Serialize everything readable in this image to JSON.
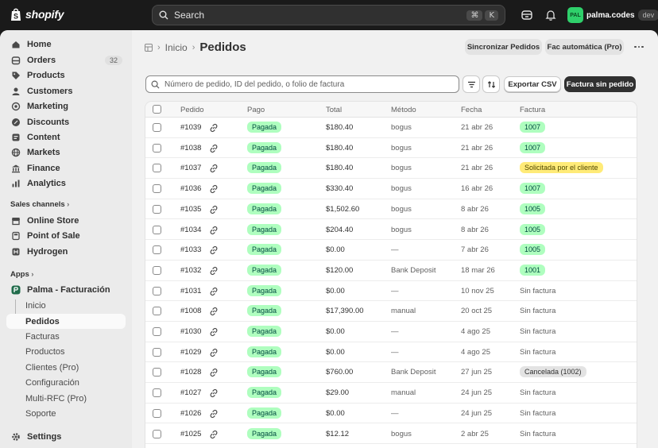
{
  "topbar": {
    "brand": "shopify",
    "search_placeholder": "Search",
    "shortcut": [
      "⌘",
      "K"
    ],
    "store_initials": "PAL",
    "store_name": "palma.codes",
    "store_badge": "dev"
  },
  "sidebar": {
    "items": [
      {
        "label": "Home",
        "icon": "home-icon"
      },
      {
        "label": "Orders",
        "icon": "orders-icon",
        "count": "32"
      },
      {
        "label": "Products",
        "icon": "tag-icon"
      },
      {
        "label": "Customers",
        "icon": "person-icon"
      },
      {
        "label": "Marketing",
        "icon": "target-icon"
      },
      {
        "label": "Discounts",
        "icon": "discount-icon"
      },
      {
        "label": "Content",
        "icon": "content-icon"
      },
      {
        "label": "Markets",
        "icon": "globe-icon"
      },
      {
        "label": "Finance",
        "icon": "bank-icon"
      },
      {
        "label": "Analytics",
        "icon": "chart-icon"
      }
    ],
    "sales_channels_label": "Sales channels",
    "channels": [
      {
        "label": "Online Store",
        "icon": "store-icon"
      },
      {
        "label": "Point of Sale",
        "icon": "pos-icon"
      },
      {
        "label": "Hydrogen",
        "icon": "hydrogen-icon"
      }
    ],
    "apps_label": "Apps",
    "app_name": "Palma - Facturación",
    "app_items": [
      {
        "label": "Inicio"
      },
      {
        "label": "Pedidos",
        "active": true
      },
      {
        "label": "Facturas"
      },
      {
        "label": "Productos"
      },
      {
        "label": "Clientes (Pro)"
      },
      {
        "label": "Configuración"
      },
      {
        "label": "Multi-RFC (Pro)"
      },
      {
        "label": "Soporte"
      }
    ],
    "settings_label": "Settings"
  },
  "header": {
    "breadcrumb_home": "Inicio",
    "title": "Pedidos",
    "sync_button": "Sincronizar Pedidos",
    "auto_button": "Fac automática (Pro)"
  },
  "toolbar": {
    "search_placeholder": "Número de pedido, ID del pedido, o folio de factura",
    "export_button": "Exportar CSV",
    "invoice_button": "Factura sin pedido"
  },
  "table": {
    "columns": [
      "Pedido",
      "Pago",
      "Total",
      "Método",
      "Fecha",
      "Factura"
    ],
    "rows": [
      {
        "order": "#1039",
        "payment": "Pagada",
        "total": "$180.40",
        "method": "bogus",
        "date": "21 abr 26",
        "invoice": "1007",
        "invoice_style": "green"
      },
      {
        "order": "#1038",
        "payment": "Pagada",
        "total": "$180.40",
        "method": "bogus",
        "date": "21 abr 26",
        "invoice": "1007",
        "invoice_style": "green"
      },
      {
        "order": "#1037",
        "payment": "Pagada",
        "total": "$180.40",
        "method": "bogus",
        "date": "21 abr 26",
        "invoice": "Solicitada por el cliente",
        "invoice_style": "yellow"
      },
      {
        "order": "#1036",
        "payment": "Pagada",
        "total": "$330.40",
        "method": "bogus",
        "date": "16 abr 26",
        "invoice": "1007",
        "invoice_style": "green"
      },
      {
        "order": "#1035",
        "payment": "Pagada",
        "total": "$1,502.60",
        "method": "bogus",
        "date": "8 abr 26",
        "invoice": "1005",
        "invoice_style": "green"
      },
      {
        "order": "#1034",
        "payment": "Pagada",
        "total": "$204.40",
        "method": "bogus",
        "date": "8 abr 26",
        "invoice": "1005",
        "invoice_style": "green"
      },
      {
        "order": "#1033",
        "payment": "Pagada",
        "total": "$0.00",
        "method": "—",
        "date": "7 abr 26",
        "invoice": "1005",
        "invoice_style": "green"
      },
      {
        "order": "#1032",
        "payment": "Pagada",
        "total": "$120.00",
        "method": "Bank Deposit",
        "date": "18 mar 26",
        "invoice": "1001",
        "invoice_style": "green"
      },
      {
        "order": "#1031",
        "payment": "Pagada",
        "total": "$0.00",
        "method": "—",
        "date": "10 nov 25",
        "invoice": "Sin factura",
        "invoice_style": "text"
      },
      {
        "order": "#1008",
        "payment": "Pagada",
        "total": "$17,390.00",
        "method": "manual",
        "date": "20 oct 25",
        "invoice": "Sin factura",
        "invoice_style": "text"
      },
      {
        "order": "#1030",
        "payment": "Pagada",
        "total": "$0.00",
        "method": "—",
        "date": "4 ago 25",
        "invoice": "Sin factura",
        "invoice_style": "text"
      },
      {
        "order": "#1029",
        "payment": "Pagada",
        "total": "$0.00",
        "method": "—",
        "date": "4 ago 25",
        "invoice": "Sin factura",
        "invoice_style": "text"
      },
      {
        "order": "#1028",
        "payment": "Pagada",
        "total": "$760.00",
        "method": "Bank Deposit",
        "date": "27 jun 25",
        "invoice": "Cancelada (1002)",
        "invoice_style": "gray"
      },
      {
        "order": "#1027",
        "payment": "Pagada",
        "total": "$29.00",
        "method": "manual",
        "date": "24 jun 25",
        "invoice": "Sin factura",
        "invoice_style": "text"
      },
      {
        "order": "#1026",
        "payment": "Pagada",
        "total": "$0.00",
        "method": "—",
        "date": "24 jun 25",
        "invoice": "Sin factura",
        "invoice_style": "text"
      },
      {
        "order": "#1025",
        "payment": "Pagada",
        "total": "$12.12",
        "method": "bogus",
        "date": "2 abr 25",
        "invoice": "Sin factura",
        "invoice_style": "text"
      }
    ]
  },
  "colors": {
    "paid_bg": "#affebf",
    "requested_bg": "#ffeb78",
    "cancelled_bg": "#e3e3e3",
    "topbar_bg": "#1a1a1a",
    "store_avatar": "#2fd06b"
  }
}
